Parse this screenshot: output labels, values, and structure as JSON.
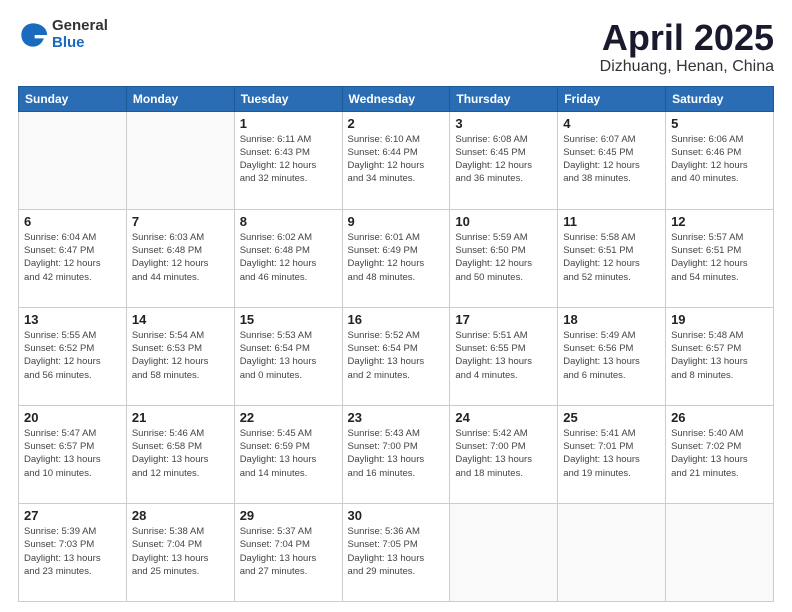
{
  "header": {
    "logo_general": "General",
    "logo_blue": "Blue",
    "title": "April 2025",
    "subtitle": "Dizhuang, Henan, China"
  },
  "calendar": {
    "days_of_week": [
      "Sunday",
      "Monday",
      "Tuesday",
      "Wednesday",
      "Thursday",
      "Friday",
      "Saturday"
    ],
    "weeks": [
      [
        {
          "day": "",
          "info": ""
        },
        {
          "day": "",
          "info": ""
        },
        {
          "day": "1",
          "info": "Sunrise: 6:11 AM\nSunset: 6:43 PM\nDaylight: 12 hours\nand 32 minutes."
        },
        {
          "day": "2",
          "info": "Sunrise: 6:10 AM\nSunset: 6:44 PM\nDaylight: 12 hours\nand 34 minutes."
        },
        {
          "day": "3",
          "info": "Sunrise: 6:08 AM\nSunset: 6:45 PM\nDaylight: 12 hours\nand 36 minutes."
        },
        {
          "day": "4",
          "info": "Sunrise: 6:07 AM\nSunset: 6:45 PM\nDaylight: 12 hours\nand 38 minutes."
        },
        {
          "day": "5",
          "info": "Sunrise: 6:06 AM\nSunset: 6:46 PM\nDaylight: 12 hours\nand 40 minutes."
        }
      ],
      [
        {
          "day": "6",
          "info": "Sunrise: 6:04 AM\nSunset: 6:47 PM\nDaylight: 12 hours\nand 42 minutes."
        },
        {
          "day": "7",
          "info": "Sunrise: 6:03 AM\nSunset: 6:48 PM\nDaylight: 12 hours\nand 44 minutes."
        },
        {
          "day": "8",
          "info": "Sunrise: 6:02 AM\nSunset: 6:48 PM\nDaylight: 12 hours\nand 46 minutes."
        },
        {
          "day": "9",
          "info": "Sunrise: 6:01 AM\nSunset: 6:49 PM\nDaylight: 12 hours\nand 48 minutes."
        },
        {
          "day": "10",
          "info": "Sunrise: 5:59 AM\nSunset: 6:50 PM\nDaylight: 12 hours\nand 50 minutes."
        },
        {
          "day": "11",
          "info": "Sunrise: 5:58 AM\nSunset: 6:51 PM\nDaylight: 12 hours\nand 52 minutes."
        },
        {
          "day": "12",
          "info": "Sunrise: 5:57 AM\nSunset: 6:51 PM\nDaylight: 12 hours\nand 54 minutes."
        }
      ],
      [
        {
          "day": "13",
          "info": "Sunrise: 5:55 AM\nSunset: 6:52 PM\nDaylight: 12 hours\nand 56 minutes."
        },
        {
          "day": "14",
          "info": "Sunrise: 5:54 AM\nSunset: 6:53 PM\nDaylight: 12 hours\nand 58 minutes."
        },
        {
          "day": "15",
          "info": "Sunrise: 5:53 AM\nSunset: 6:54 PM\nDaylight: 13 hours\nand 0 minutes."
        },
        {
          "day": "16",
          "info": "Sunrise: 5:52 AM\nSunset: 6:54 PM\nDaylight: 13 hours\nand 2 minutes."
        },
        {
          "day": "17",
          "info": "Sunrise: 5:51 AM\nSunset: 6:55 PM\nDaylight: 13 hours\nand 4 minutes."
        },
        {
          "day": "18",
          "info": "Sunrise: 5:49 AM\nSunset: 6:56 PM\nDaylight: 13 hours\nand 6 minutes."
        },
        {
          "day": "19",
          "info": "Sunrise: 5:48 AM\nSunset: 6:57 PM\nDaylight: 13 hours\nand 8 minutes."
        }
      ],
      [
        {
          "day": "20",
          "info": "Sunrise: 5:47 AM\nSunset: 6:57 PM\nDaylight: 13 hours\nand 10 minutes."
        },
        {
          "day": "21",
          "info": "Sunrise: 5:46 AM\nSunset: 6:58 PM\nDaylight: 13 hours\nand 12 minutes."
        },
        {
          "day": "22",
          "info": "Sunrise: 5:45 AM\nSunset: 6:59 PM\nDaylight: 13 hours\nand 14 minutes."
        },
        {
          "day": "23",
          "info": "Sunrise: 5:43 AM\nSunset: 7:00 PM\nDaylight: 13 hours\nand 16 minutes."
        },
        {
          "day": "24",
          "info": "Sunrise: 5:42 AM\nSunset: 7:00 PM\nDaylight: 13 hours\nand 18 minutes."
        },
        {
          "day": "25",
          "info": "Sunrise: 5:41 AM\nSunset: 7:01 PM\nDaylight: 13 hours\nand 19 minutes."
        },
        {
          "day": "26",
          "info": "Sunrise: 5:40 AM\nSunset: 7:02 PM\nDaylight: 13 hours\nand 21 minutes."
        }
      ],
      [
        {
          "day": "27",
          "info": "Sunrise: 5:39 AM\nSunset: 7:03 PM\nDaylight: 13 hours\nand 23 minutes."
        },
        {
          "day": "28",
          "info": "Sunrise: 5:38 AM\nSunset: 7:04 PM\nDaylight: 13 hours\nand 25 minutes."
        },
        {
          "day": "29",
          "info": "Sunrise: 5:37 AM\nSunset: 7:04 PM\nDaylight: 13 hours\nand 27 minutes."
        },
        {
          "day": "30",
          "info": "Sunrise: 5:36 AM\nSunset: 7:05 PM\nDaylight: 13 hours\nand 29 minutes."
        },
        {
          "day": "",
          "info": ""
        },
        {
          "day": "",
          "info": ""
        },
        {
          "day": "",
          "info": ""
        }
      ]
    ]
  }
}
